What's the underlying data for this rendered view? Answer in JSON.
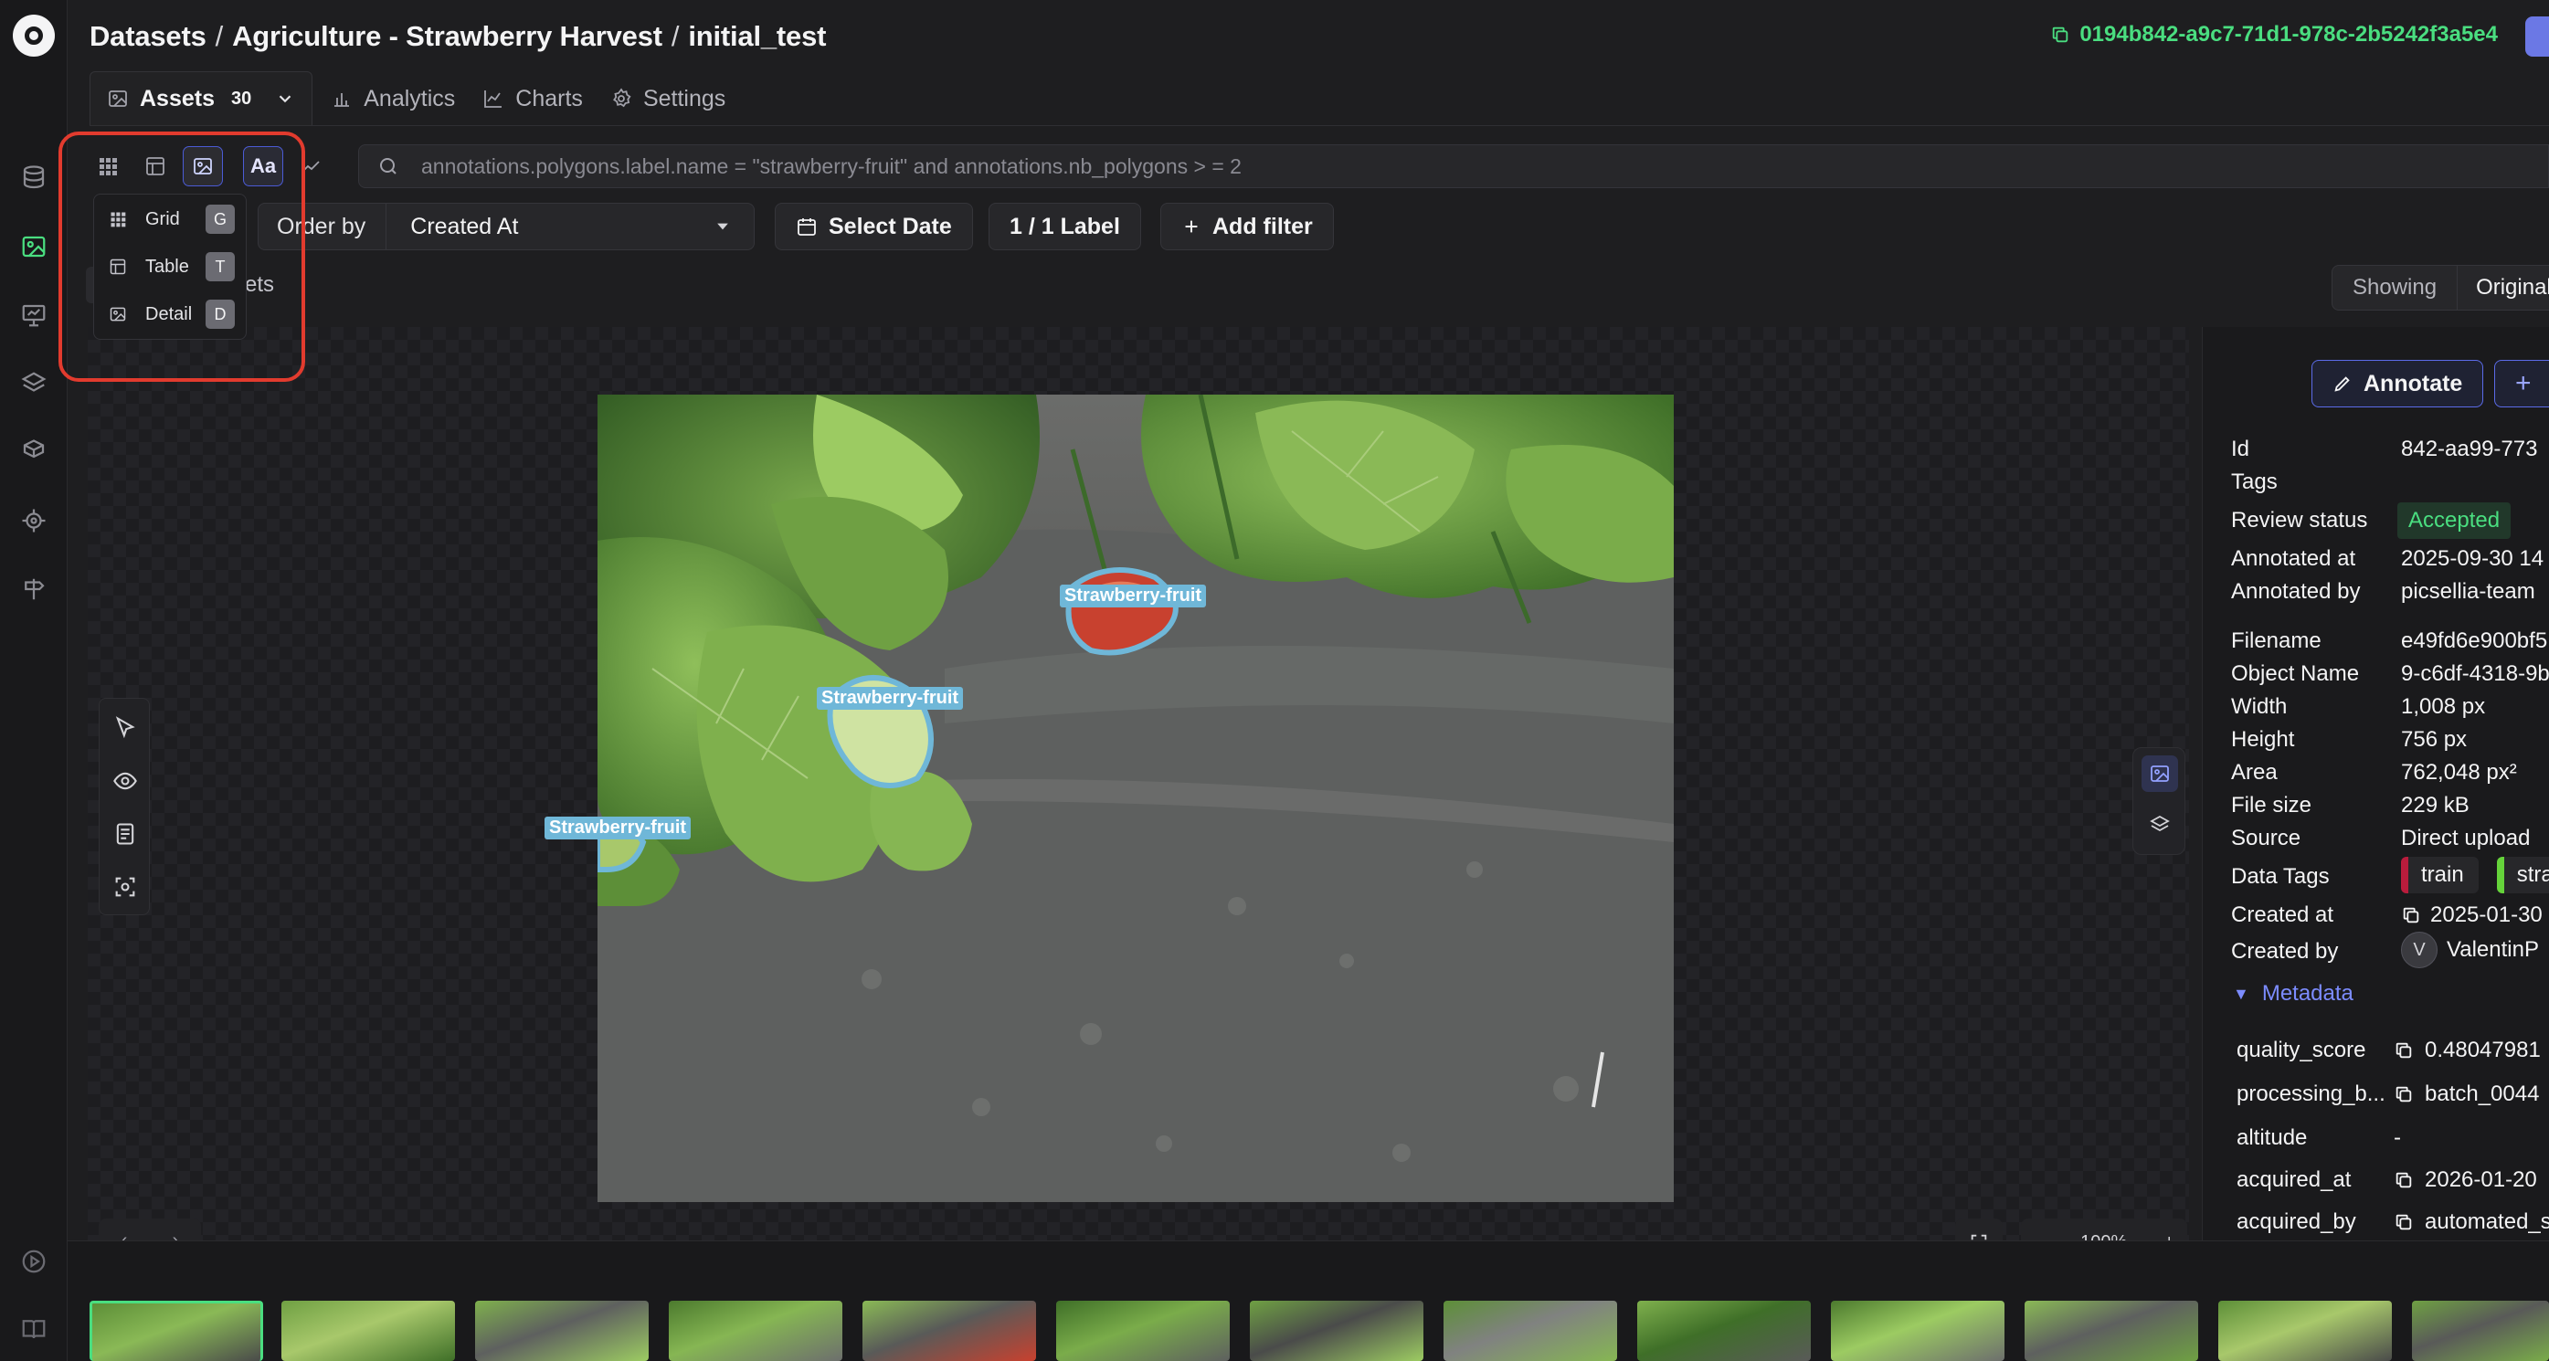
{
  "header": {
    "breadcrumb": [
      "Datasets",
      "Agriculture - Strawberry Harvest",
      "initial_test"
    ],
    "dataset_id": "0194b842-a9c7-71d1-978c-2b5242f3a5e4"
  },
  "tabs": [
    {
      "label": "Assets",
      "count": "30",
      "icon": "image-icon"
    },
    {
      "label": "Analytics",
      "icon": "bar-chart-icon"
    },
    {
      "label": "Charts",
      "icon": "line-chart-icon"
    },
    {
      "label": "Settings",
      "icon": "gear-icon"
    }
  ],
  "toolbar": {
    "text_toggle": "Aa",
    "search_value": "annotations.polygons.label.name = \"strawberry-fruit\" and annotations.nb_polygons > = 2",
    "order_by_label": "Order by",
    "order_by_value": "Created At",
    "select_date": "Select Date",
    "label_count": "1 / 1 Label",
    "add_filter": "Add filter"
  },
  "view_menu": [
    {
      "label": "Grid",
      "key": "G"
    },
    {
      "label": "Table",
      "key": "T"
    },
    {
      "label": "Detail",
      "key": "D"
    }
  ],
  "assets_partial": "ssets",
  "showing": {
    "label": "Showing",
    "value": "Original"
  },
  "annotations": [
    {
      "label": "Strawberry-fruit"
    },
    {
      "label": "Strawberry-fruit"
    },
    {
      "label": "Strawberry-fruit"
    }
  ],
  "zoom": "100%",
  "panel": {
    "annotate": "Annotate",
    "props": [
      {
        "key": "Id",
        "value": "842-aa99-773"
      },
      {
        "key": "Tags",
        "value": ""
      },
      {
        "key": "Review status",
        "value": "Accepted"
      },
      {
        "key": "Annotated at",
        "value": "2025-09-30 14"
      },
      {
        "key": "Annotated by",
        "value": "picsellia-team"
      },
      {
        "key": "Filename",
        "value": "e49fd6e900bf5"
      },
      {
        "key": "Object Name",
        "value": "9-c6df-4318-9b"
      },
      {
        "key": "Width",
        "value": "1,008 px"
      },
      {
        "key": "Height",
        "value": "756 px"
      },
      {
        "key": "Area",
        "value": "762,048 px²"
      },
      {
        "key": "File size",
        "value": "229 kB"
      },
      {
        "key": "Source",
        "value": "Direct upload"
      },
      {
        "key": "Data Tags",
        "value": ""
      },
      {
        "key": "Created at",
        "value": "2025-01-30"
      },
      {
        "key": "Created by",
        "value": "ValentinP"
      }
    ],
    "data_tags": [
      "train",
      "stra"
    ],
    "creator_initial": "V",
    "metadata_title": "Metadata",
    "metadata": [
      {
        "key": "quality_score",
        "value": "0.48047981"
      },
      {
        "key": "processing_b...",
        "value": "batch_0044"
      },
      {
        "key": "altitude",
        "value": "-"
      },
      {
        "key": "acquired_at",
        "value": "2026-01-20"
      },
      {
        "key": "acquired_by",
        "value": "automated_s"
      }
    ]
  }
}
